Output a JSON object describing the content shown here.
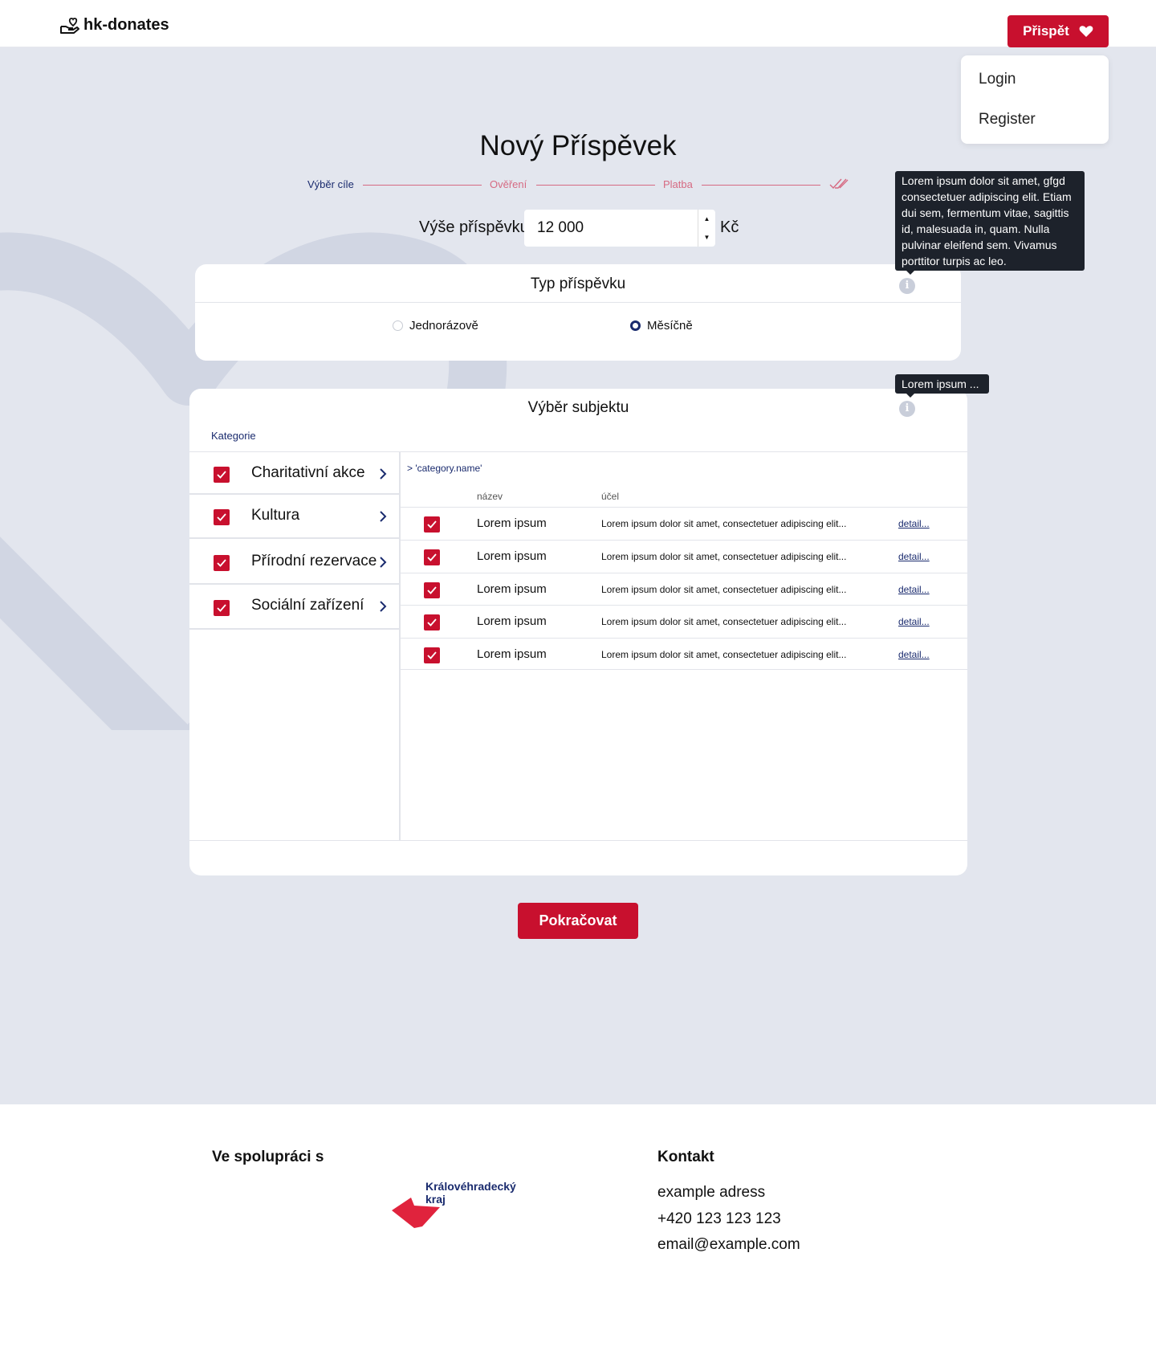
{
  "header": {
    "logo_text": "hk-donates",
    "donate_button": "Přispět"
  },
  "account_menu": {
    "items": [
      "Login",
      "Register"
    ]
  },
  "page_title": "Nový Příspěvek",
  "stepper": {
    "steps": [
      "Výběr cíle",
      "Ověření",
      "Platba"
    ],
    "active_step": 0
  },
  "amount": {
    "label": "Výše příspěvku",
    "value": "12 000",
    "currency": "Kč"
  },
  "contribution_type": {
    "title": "Typ příspěvku",
    "options": [
      "Jednorázově",
      "Měsíčně"
    ],
    "selected": "Měsíčně",
    "tooltip": "Lorem ipsum dolor sit amet, gfgd consectetuer adipiscing elit. Etiam dui sem, fermentum vitae, sagittis id, malesuada in, quam. Nulla pulvinar eleifend sem. Vivamus porttitor turpis ac leo."
  },
  "subject_selection": {
    "title": "Výběr subjektu",
    "tooltip": "Lorem ipsum ...",
    "categories_label": "Kategorie",
    "categories": [
      {
        "label": "Charitativní akce",
        "checked": true
      },
      {
        "label": "Kultura",
        "checked": true
      },
      {
        "label": "Přírodní rezervace",
        "checked": true
      },
      {
        "label": "Sociální zařízení",
        "checked": true
      }
    ],
    "breadcrumb": "> 'category.name'",
    "columns": {
      "name": "název",
      "purpose": "účel"
    },
    "rows": [
      {
        "name": "Lorem ipsum",
        "purpose": "Lorem ipsum dolor sit amet, consectetuer adipiscing elit...",
        "detail": "detail...",
        "checked": true
      },
      {
        "name": "Lorem ipsum",
        "purpose": "Lorem ipsum dolor sit amet, consectetuer adipiscing elit...",
        "detail": "detail...",
        "checked": true
      },
      {
        "name": "Lorem ipsum",
        "purpose": "Lorem ipsum dolor sit amet, consectetuer adipiscing elit...",
        "detail": "detail...",
        "checked": true
      },
      {
        "name": "Lorem ipsum",
        "purpose": "Lorem ipsum dolor sit amet, consectetuer adipiscing elit...",
        "detail": "detail...",
        "checked": true
      },
      {
        "name": "Lorem ipsum",
        "purpose": "Lorem ipsum dolor sit amet, consectetuer adipiscing elit...",
        "detail": "detail...",
        "checked": true
      }
    ]
  },
  "continue_button": "Pokračovat",
  "footer": {
    "partners_heading": "Ve spolupráci s",
    "partner_logo_text": "Královéhradecký kraj",
    "contact_heading": "Kontakt",
    "contact_lines": [
      "example adress",
      "+420 123 123 123",
      "email@example.com"
    ]
  },
  "colors": {
    "accent": "#c8102e",
    "navy": "#1a2b6e",
    "page_background": "#e3e6ee",
    "stepper_line": "#d66a82"
  }
}
